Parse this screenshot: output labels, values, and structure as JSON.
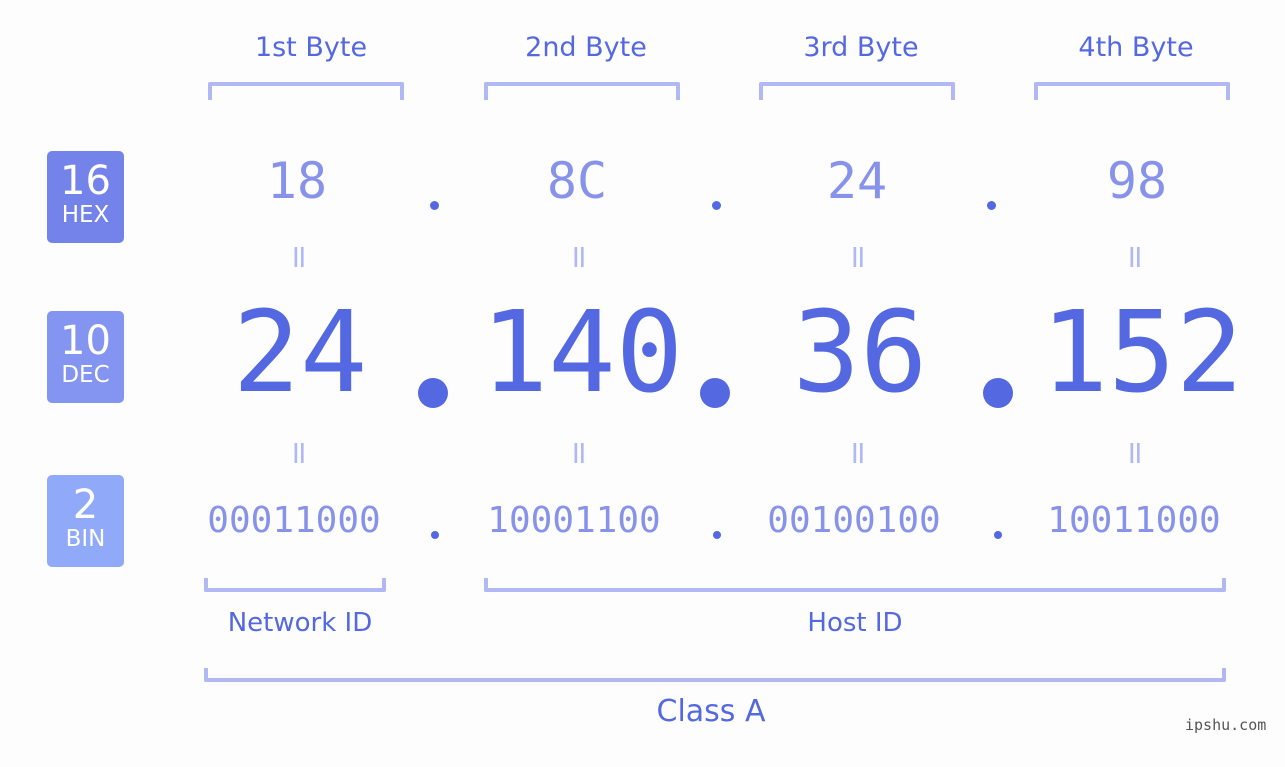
{
  "colors": {
    "accent": "#5468e2",
    "light": "#8792ea",
    "bracket": "#b0b9f4",
    "hex_badge": "#7383ea",
    "dec_badge": "#8494f1",
    "bin_badge": "#91a9f9"
  },
  "headers": [
    "1st Byte",
    "2nd Byte",
    "3rd Byte",
    "4th Byte"
  ],
  "badges": [
    {
      "num": "16",
      "label": "HEX"
    },
    {
      "num": "10",
      "label": "DEC"
    },
    {
      "num": "2",
      "label": "BIN"
    }
  ],
  "hex": [
    "18",
    "8C",
    "24",
    "98"
  ],
  "dec": [
    "24",
    "140",
    "36",
    "152"
  ],
  "bin": [
    "00011000",
    "10001100",
    "00100100",
    "10011000"
  ],
  "equals_glyph": "=",
  "labels": {
    "network": "Network ID",
    "host": "Host ID",
    "class": "Class A"
  },
  "watermark": "ipshu.com"
}
